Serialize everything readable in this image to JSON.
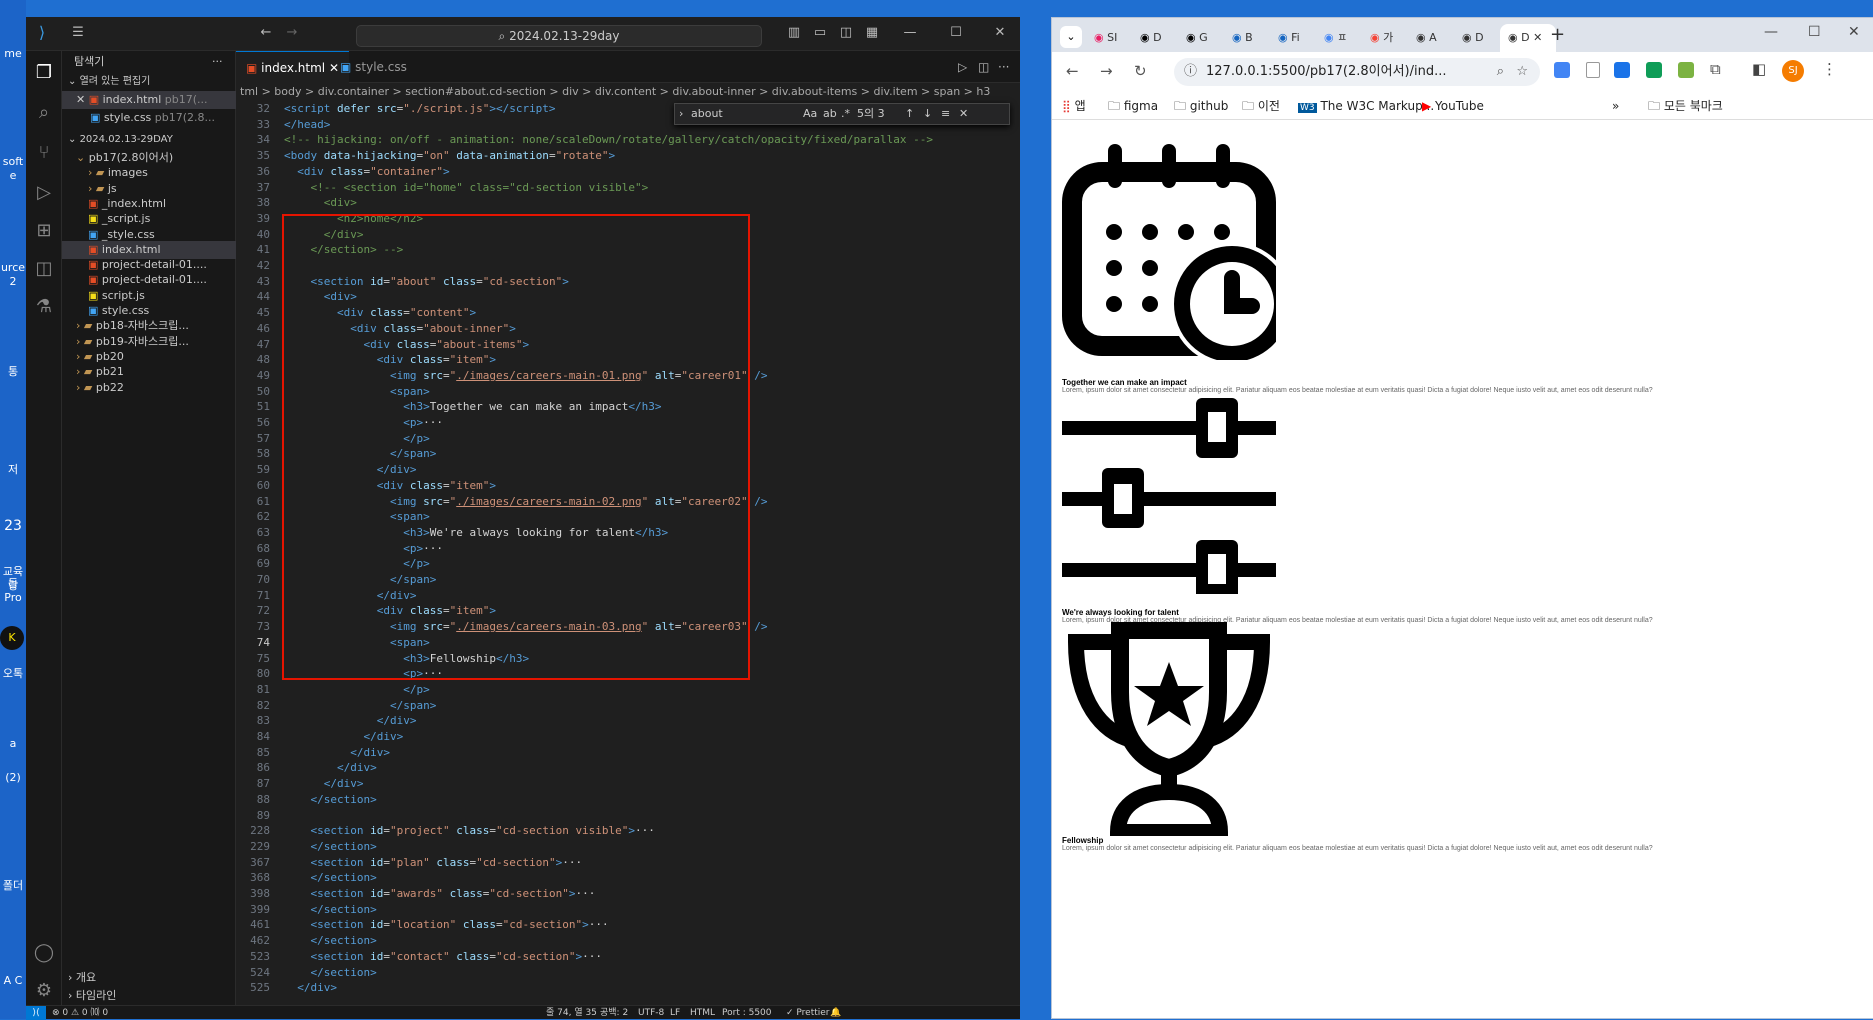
{
  "desktop": {
    "icons": [
      "me",
      "soft",
      "e",
      "urce",
      "2",
      "통",
      "저",
      "23",
      "교육등",
      "랑Pro",
      "K",
      "오톡",
      "a",
      "(2)",
      "폴더",
      "A C"
    ]
  },
  "vscode": {
    "search": "2024.02.13-29day",
    "sidebar": {
      "title": "탐색기",
      "open_editors": "열려 있는 편집기",
      "open_files": [
        {
          "name": "index.html",
          "dir": "pb17(..."
        },
        {
          "name": "style.css",
          "dir": "pb17(2.8..."
        }
      ],
      "workspace": "2024.02.13-29DAY",
      "tree": [
        {
          "name": "pb17(2.8이어서)",
          "kind": "folder-open"
        },
        {
          "name": "images",
          "kind": "folder"
        },
        {
          "name": "js",
          "kind": "folder"
        },
        {
          "name": "_index.html",
          "kind": "html"
        },
        {
          "name": "_script.js",
          "kind": "js"
        },
        {
          "name": "_style.css",
          "kind": "css"
        },
        {
          "name": "index.html",
          "kind": "html"
        },
        {
          "name": "project-detail-01....",
          "kind": "html"
        },
        {
          "name": "project-detail-01....",
          "kind": "html"
        },
        {
          "name": "script.js",
          "kind": "js"
        },
        {
          "name": "style.css",
          "kind": "css"
        },
        {
          "name": "pb18-자바스크립...",
          "kind": "folder"
        },
        {
          "name": "pb19-자바스크립...",
          "kind": "folder"
        },
        {
          "name": "pb20",
          "kind": "folder"
        },
        {
          "name": "pb21",
          "kind": "folder"
        },
        {
          "name": "pb22",
          "kind": "folder"
        }
      ],
      "outline": "개요",
      "timeline": "타임라인"
    },
    "tabs": [
      {
        "label": "index.html"
      },
      {
        "label": "style.css"
      }
    ],
    "breadcrumb": "tml > body > div.container > section#about.cd-section > div > div.content > div.about-inner > div.about-items > div.item > span > h3",
    "find": {
      "value": "about",
      "aa": "Aa",
      "count": "5의 3"
    },
    "lines": [
      {
        "n": "32",
        "html": "<span class='t'>&lt;script</span> <span class='a'>defer</span> <span class='a'>src</span>=<span class='s'>\"./script.js\"</span><span class='t'>&gt;&lt;/script&gt;</span>"
      },
      {
        "n": "33",
        "html": "<span class='t'>&lt;/head&gt;</span>"
      },
      {
        "n": "34",
        "html": "<span class='c'>&lt;!-- hijacking: on/off - animation: none/scaleDown/rotate/gallery/catch/opacity/fixed/parallax --&gt;</span>"
      },
      {
        "n": "35",
        "html": "<span class='t'>&lt;body</span> <span class='a'>data-hijacking</span>=<span class='s'>\"on\"</span> <span class='a'>data-animation</span>=<span class='s'>\"rotate\"</span><span class='t'>&gt;</span>"
      },
      {
        "n": "36",
        "html": "  <span class='t'>&lt;div</span> <span class='a'>class</span>=<span class='s'>\"container\"</span><span class='t'>&gt;</span>"
      },
      {
        "n": "37",
        "html": "    <span class='c'>&lt;!-- &lt;section id=\"home\" class=\"cd-section visible\"&gt;</span>"
      },
      {
        "n": "38",
        "html": "<span class='c'>      &lt;div&gt;</span>"
      },
      {
        "n": "39",
        "html": "<span class='c'>        &lt;h2&gt;home&lt;/h2&gt;</span>"
      },
      {
        "n": "40",
        "html": "<span class='c'>      &lt;/div&gt;</span>"
      },
      {
        "n": "41",
        "html": "<span class='c'>    &lt;/section&gt; --&gt;</span>"
      },
      {
        "n": "42",
        "html": ""
      },
      {
        "n": "43",
        "html": "    <span class='t'>&lt;section</span> <span class='a'>id</span>=<span class='s'>\"about\"</span> <span class='a'>class</span>=<span class='s'>\"cd-section\"</span><span class='t'>&gt;</span>"
      },
      {
        "n": "44",
        "html": "      <span class='t'>&lt;div&gt;</span>"
      },
      {
        "n": "45",
        "html": "        <span class='t'>&lt;div</span> <span class='a'>class</span>=<span class='s'>\"content\"</span><span class='t'>&gt;</span>"
      },
      {
        "n": "46",
        "html": "          <span class='t'>&lt;div</span> <span class='a'>class</span>=<span class='s'>\"about-inner\"</span><span class='t'>&gt;</span>"
      },
      {
        "n": "47",
        "html": "            <span class='t'>&lt;div</span> <span class='a'>class</span>=<span class='s'>\"about-items\"</span><span class='t'>&gt;</span>"
      },
      {
        "n": "48",
        "html": "              <span class='t'>&lt;div</span> <span class='a'>class</span>=<span class='s'>\"item\"</span><span class='t'>&gt;</span>"
      },
      {
        "n": "49",
        "html": "                <span class='t'>&lt;img</span> <span class='a'>src</span>=<span class='s'>\"<span class='u'>./images/careers-main-01.png</span>\"</span> <span class='a'>alt</span>=<span class='s'>\"career01\"</span> <span class='t'>/&gt;</span>"
      },
      {
        "n": "50",
        "html": "                <span class='t'>&lt;span&gt;</span>"
      },
      {
        "n": "51",
        "html": "                  <span class='t'>&lt;h3&gt;</span><span class='w'>Together we can make an impact</span><span class='t'>&lt;/h3&gt;</span>"
      },
      {
        "n": "56",
        "html": "                  <span class='t'>&lt;p&gt;</span><span class='w'>···</span>"
      },
      {
        "n": "57",
        "html": "                  <span class='t'>&lt;/p&gt;</span>"
      },
      {
        "n": "58",
        "html": "                <span class='t'>&lt;/span&gt;</span>"
      },
      {
        "n": "59",
        "html": "              <span class='t'>&lt;/div&gt;</span>"
      },
      {
        "n": "60",
        "html": "              <span class='t'>&lt;div</span> <span class='a'>class</span>=<span class='s'>\"item\"</span><span class='t'>&gt;</span>"
      },
      {
        "n": "61",
        "html": "                <span class='t'>&lt;img</span> <span class='a'>src</span>=<span class='s'>\"<span class='u'>./images/careers-main-02.png</span>\"</span> <span class='a'>alt</span>=<span class='s'>\"career02\"</span> <span class='t'>/&gt;</span>"
      },
      {
        "n": "62",
        "html": "                <span class='t'>&lt;span&gt;</span>"
      },
      {
        "n": "63",
        "html": "                  <span class='t'>&lt;h3&gt;</span><span class='w'>We're always looking for talent</span><span class='t'>&lt;/h3&gt;</span>"
      },
      {
        "n": "68",
        "html": "                  <span class='t'>&lt;p&gt;</span><span class='w'>···</span>"
      },
      {
        "n": "69",
        "html": "                  <span class='t'>&lt;/p&gt;</span>"
      },
      {
        "n": "70",
        "html": "                <span class='t'>&lt;/span&gt;</span>"
      },
      {
        "n": "71",
        "html": "              <span class='t'>&lt;/div&gt;</span>"
      },
      {
        "n": "72",
        "html": "              <span class='t'>&lt;div</span> <span class='a'>class</span>=<span class='s'>\"item\"</span><span class='t'>&gt;</span>"
      },
      {
        "n": "73",
        "html": "                <span class='t'>&lt;img</span> <span class='a'>src</span>=<span class='s'>\"<span class='u'>./images/careers-main-03.png</span>\"</span> <span class='a'>alt</span>=<span class='s'>\"career03\"</span> <span class='t'>/&gt;</span>"
      },
      {
        "n": "74",
        "html": "                <span class='t'>&lt;span&gt;</span>"
      },
      {
        "n": "75",
        "html": "                  <span class='t'>&lt;h3&gt;</span><span class='w'>Fellowship</span><span class='t'>&lt;/h3&gt;</span>"
      },
      {
        "n": "80",
        "html": "                  <span class='t'>&lt;p&gt;</span><span class='w'>···</span>"
      },
      {
        "n": "81",
        "html": "                  <span class='t'>&lt;/p&gt;</span>"
      },
      {
        "n": "82",
        "html": "                <span class='t'>&lt;/span&gt;</span>"
      },
      {
        "n": "83",
        "html": "              <span class='t'>&lt;/div&gt;</span>"
      },
      {
        "n": "84",
        "html": "            <span class='t'>&lt;/div&gt;</span>"
      },
      {
        "n": "85",
        "html": "          <span class='t'>&lt;/div&gt;</span>"
      },
      {
        "n": "86",
        "html": "        <span class='t'>&lt;/div&gt;</span>"
      },
      {
        "n": "87",
        "html": "      <span class='t'>&lt;/div&gt;</span>"
      },
      {
        "n": "88",
        "html": "    <span class='t'>&lt;/section&gt;</span>"
      },
      {
        "n": "89",
        "html": ""
      },
      {
        "n": "228",
        "html": "    <span class='t'>&lt;section</span> <span class='a'>id</span>=<span class='s'>\"project\"</span> <span class='a'>class</span>=<span class='s'>\"cd-section visible\"</span><span class='t'>&gt;</span><span class='w'>···</span>"
      },
      {
        "n": "229",
        "html": "    <span class='t'>&lt;/section&gt;</span>"
      },
      {
        "n": "367",
        "html": "    <span class='t'>&lt;section</span> <span class='a'>id</span>=<span class='s'>\"plan\"</span> <span class='a'>class</span>=<span class='s'>\"cd-section\"</span><span class='t'>&gt;</span><span class='w'>···</span>"
      },
      {
        "n": "368",
        "html": "    <span class='t'>&lt;/section&gt;</span>"
      },
      {
        "n": "398",
        "html": "    <span class='t'>&lt;section</span> <span class='a'>id</span>=<span class='s'>\"awards\"</span> <span class='a'>class</span>=<span class='s'>\"cd-section\"</span><span class='t'>&gt;</span><span class='w'>···</span>"
      },
      {
        "n": "399",
        "html": "    <span class='t'>&lt;/section&gt;</span>"
      },
      {
        "n": "461",
        "html": "    <span class='t'>&lt;section</span> <span class='a'>id</span>=<span class='s'>\"location\"</span> <span class='a'>class</span>=<span class='s'>\"cd-section\"</span><span class='t'>&gt;</span><span class='w'>···</span>"
      },
      {
        "n": "462",
        "html": "    <span class='t'>&lt;/section&gt;</span>"
      },
      {
        "n": "523",
        "html": "    <span class='t'>&lt;section</span> <span class='a'>id</span>=<span class='s'>\"contact\"</span> <span class='a'>class</span>=<span class='s'>\"cd-section\"</span><span class='t'>&gt;</span><span class='w'>···</span>"
      },
      {
        "n": "524",
        "html": "    <span class='t'>&lt;/section&gt;</span>"
      },
      {
        "n": "525",
        "html": "  <span class='t'>&lt;/div&gt;</span>"
      }
    ],
    "status": {
      "left": "⊗ 0 ⚠ 0   ⑽ 0",
      "pos": "줄 74, 열 35",
      "spaces": "공백: 2",
      "enc": "UTF-8",
      "eol": "LF",
      "lang": "HTML",
      "port": "Port : 5500",
      "prettier": "✓ Prettier"
    }
  },
  "chrome": {
    "tabs": [
      "SI",
      "D",
      "G",
      "B",
      "Fi",
      "ㅍ",
      "가",
      "A",
      "D",
      "D"
    ],
    "url": "127.0.0.1:5500/pb17(2.8이어서)/ind...",
    "bookmarks": [
      "앱",
      "figma",
      "github",
      "이전",
      "The W3C Markup...",
      "YouTube"
    ],
    "all_bookmarks": "모든 북마크",
    "profile": "SJ",
    "items": [
      {
        "title": "Together we can make an impact",
        "text": "Lorem, ipsum dolor sit amet consectetur adipisicing elit. Pariatur aliquam eos beatae molestiae at eum veritatis quasi! Dicta a fugiat dolore! Neque iusto velit aut, amet eos odit deserunt nulla?"
      },
      {
        "title": "We're always looking for talent",
        "text": "Lorem, ipsum dolor sit amet consectetur adipisicing elit. Pariatur aliquam eos beatae molestiae at eum veritatis quasi! Dicta a fugiat dolore! Neque iusto velit aut, amet eos odit deserunt nulla?"
      },
      {
        "title": "Fellowship",
        "text": "Lorem, ipsum dolor sit amet consectetur adipisicing elit. Pariatur aliquam eos beatae molestiae at eum veritatis quasi! Dicta a fugiat dolore! Neque iusto velit aut, amet eos odit deserunt nulla?"
      }
    ]
  }
}
